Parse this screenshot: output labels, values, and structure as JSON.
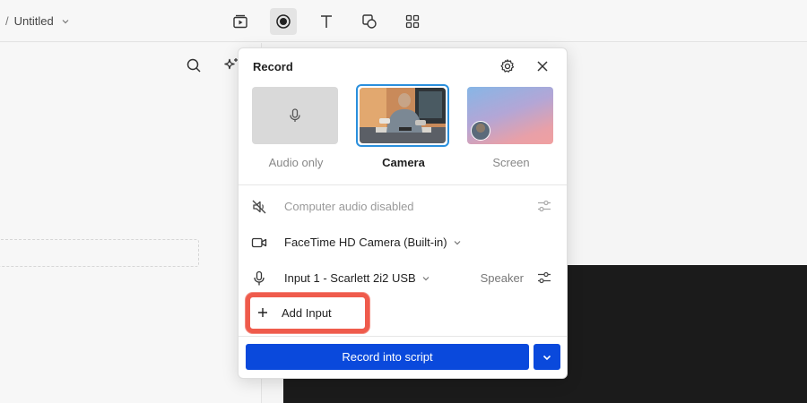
{
  "breadcrumb": {
    "separator": "/",
    "document": "Untitled"
  },
  "toolbar": {
    "tools": [
      {
        "icon": "scenes-play-icon"
      },
      {
        "icon": "record-icon",
        "active": true
      },
      {
        "icon": "text-tool-icon"
      },
      {
        "icon": "shapes-icon"
      },
      {
        "icon": "grid-icon"
      }
    ]
  },
  "left_panel": {
    "icons": [
      "search-icon",
      "sparkle-icon"
    ]
  },
  "record_popover": {
    "title": "Record",
    "modes": [
      {
        "label": "Audio only",
        "selected": false
      },
      {
        "label": "Camera",
        "selected": true
      },
      {
        "label": "Screen",
        "selected": false
      }
    ],
    "computer_audio": "Computer audio disabled",
    "camera_device": "FaceTime HD Camera (Built-in)",
    "mic_device": "Input 1 - Scarlett 2i2 USB",
    "speaker_label": "Speaker",
    "add_input": "Add Input",
    "record_button": "Record into script"
  },
  "colors": {
    "accent": "#0a49dc",
    "highlight": "#ef5b4c",
    "selected_border": "#2a8fdc",
    "canvas_dark": "#1b1b1b"
  }
}
